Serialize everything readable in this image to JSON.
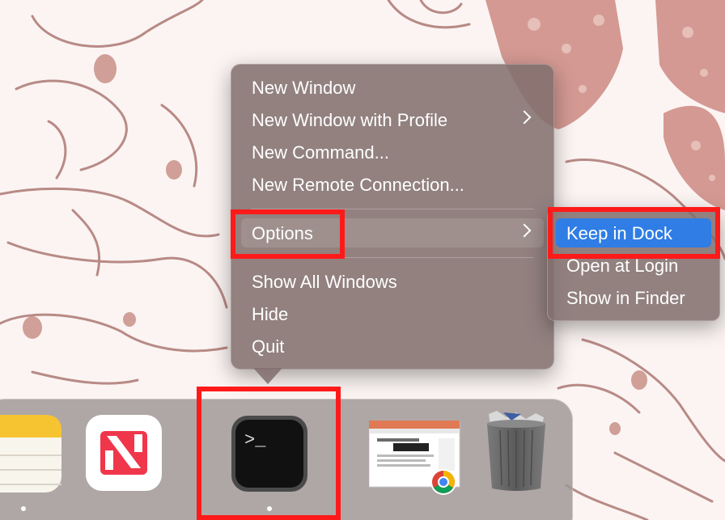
{
  "context_menu": {
    "items": [
      {
        "label": "New Window",
        "has_submenu": false
      },
      {
        "label": "New Window with Profile",
        "has_submenu": true
      },
      {
        "label": "New Command...",
        "has_submenu": false
      },
      {
        "label": "New Remote Connection...",
        "has_submenu": false
      },
      {
        "label": "Options",
        "has_submenu": true
      },
      {
        "label": "Show All Windows",
        "has_submenu": false
      },
      {
        "label": "Hide",
        "has_submenu": false
      },
      {
        "label": "Quit",
        "has_submenu": false
      }
    ]
  },
  "options_submenu": {
    "items": [
      {
        "label": "Keep in Dock",
        "selected": true
      },
      {
        "label": "Open at Login",
        "selected": false
      },
      {
        "label": "Show in Finder",
        "selected": false
      }
    ]
  },
  "dock": {
    "items": [
      {
        "name": "Notes",
        "icon": "notes-icon",
        "running": true
      },
      {
        "name": "News",
        "icon": "news-icon",
        "running": false
      },
      {
        "name": "Terminal",
        "icon": "terminal-icon",
        "running": true,
        "prompt": ">_"
      },
      {
        "name": "Chrome window",
        "icon": "chrome-window-icon",
        "running": false
      },
      {
        "name": "Trash",
        "icon": "trash-icon",
        "running": false
      }
    ]
  },
  "colors": {
    "highlight": "#2f7de5",
    "annotation": "#ff1a1a",
    "menu_bg": "#806e6c"
  }
}
